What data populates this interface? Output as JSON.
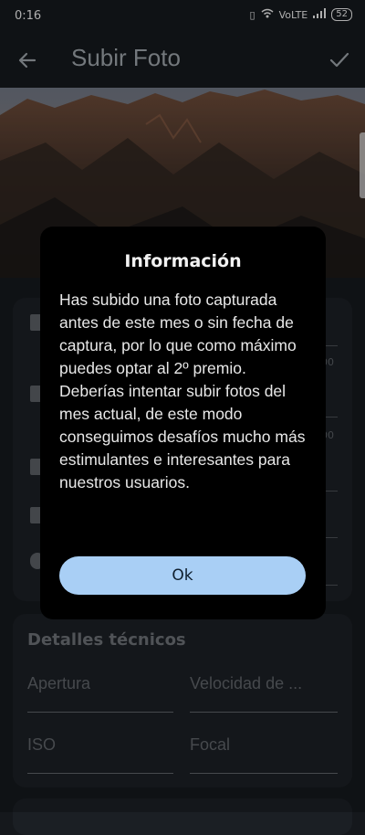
{
  "status": {
    "time": "0:16",
    "network": "VoLTE",
    "battery": "52"
  },
  "appbar": {
    "title": "Subir Foto"
  },
  "background_form": {
    "value_a": "00",
    "value_b": "00"
  },
  "technical": {
    "title": "Detalles técnicos",
    "aperture": "Apertura",
    "speed": "Velocidad de ...",
    "iso": "ISO",
    "focal": "Focal"
  },
  "dialog": {
    "title": "Información",
    "body": "Has subido una foto capturada antes de este mes o sin fecha de captura, por lo que como máximo puedes optar al 2º premio. Deberías intentar subir fotos del mes actual, de este modo conseguimos desafíos mucho más estimulantes e interesantes para nuestros usuarios.",
    "ok_label": "Ok"
  }
}
